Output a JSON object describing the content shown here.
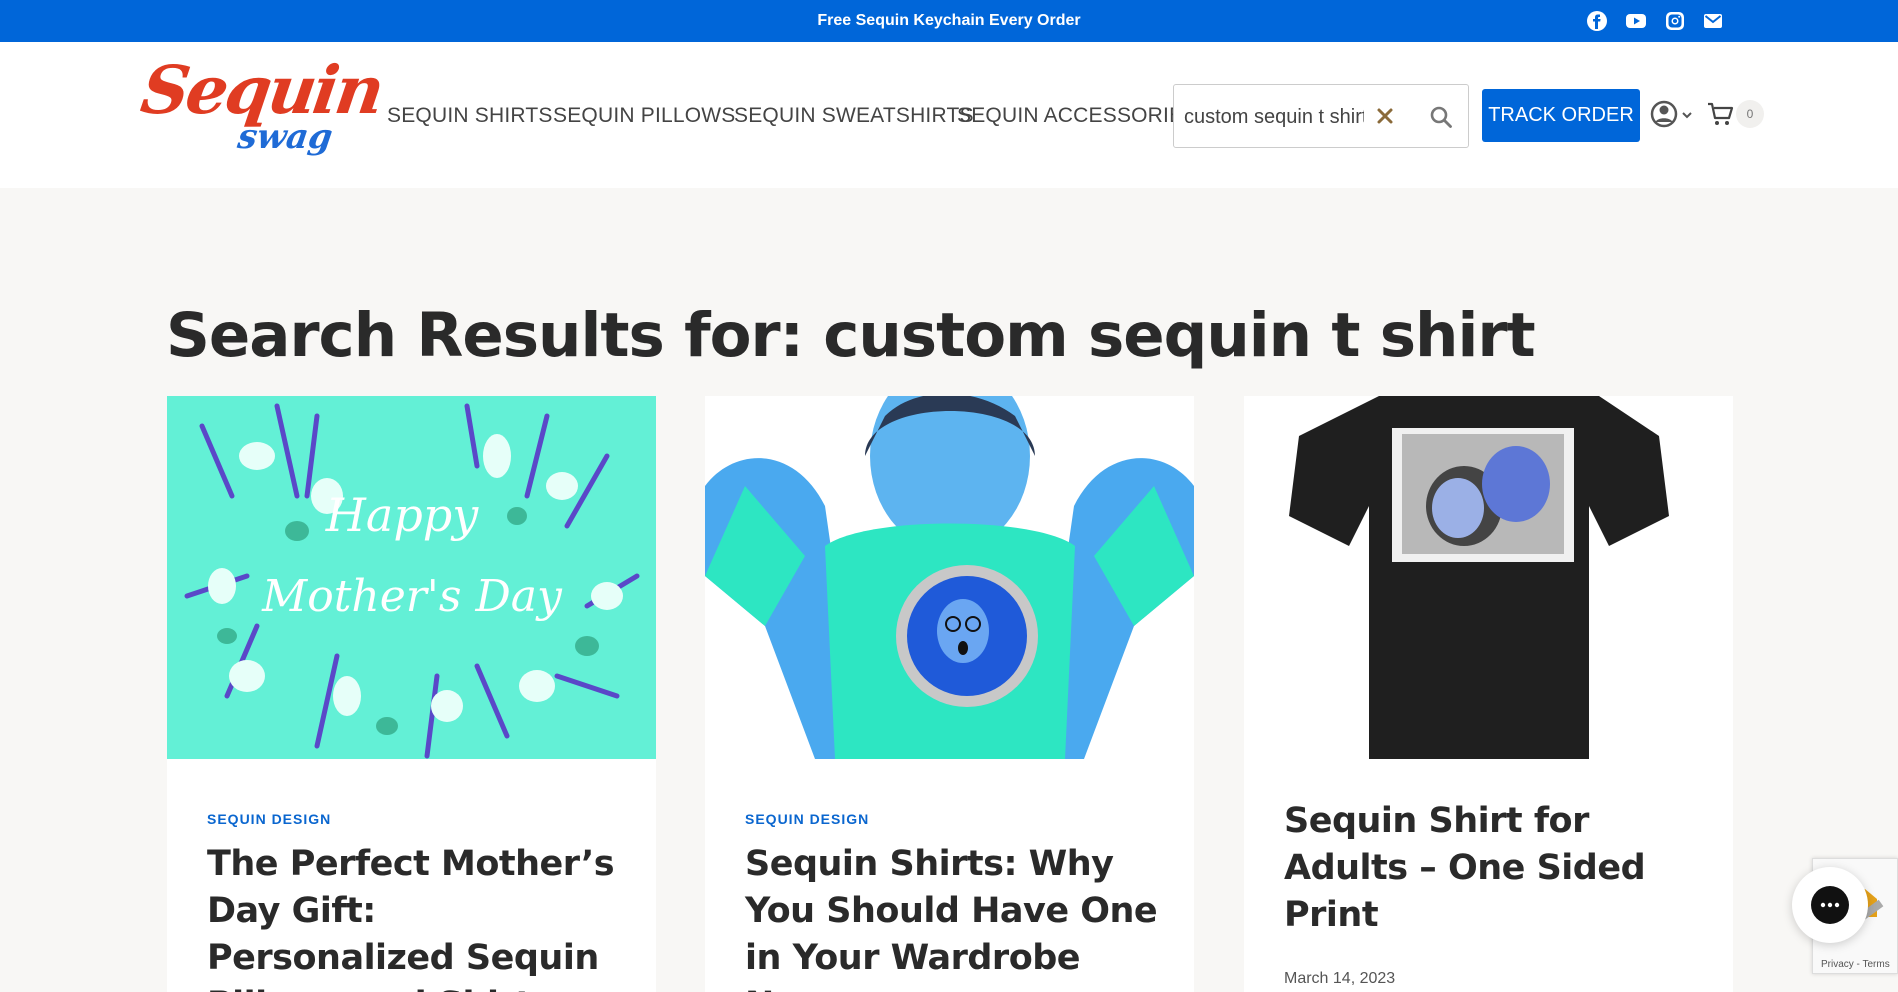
{
  "announcement": {
    "text": "Free Sequin Keychain Every Order"
  },
  "social_icons": [
    "facebook-icon",
    "youtube-icon",
    "instagram-icon",
    "email-icon"
  ],
  "logo": {
    "line1": "Sequin",
    "line2": "swag"
  },
  "nav": {
    "items": [
      {
        "label": "SEQUIN SHIRTS"
      },
      {
        "label": "SEQUIN PILLOWS"
      },
      {
        "label": "SEQUIN SWEATSHIRTS"
      },
      {
        "label": "SEQUIN ACCESSORIES"
      }
    ]
  },
  "search": {
    "value": "custom sequin t shirt",
    "clear_icon": "close-icon",
    "submit_icon": "search-icon"
  },
  "track_order": {
    "label": "TRACK ORDER"
  },
  "cart": {
    "count": "0"
  },
  "page": {
    "title": "Search Results for: custom sequin t shirt"
  },
  "results": [
    {
      "category": "SEQUIN DESIGN",
      "title": "The Perfect Mother’s Day Gift: Personalized Sequin Pillows and Shirts",
      "image_text_1": "Happy",
      "image_text_2": "Mother's Day"
    },
    {
      "category": "SEQUIN DESIGN",
      "title": "Sequin Shirts: Why You Should Have One in Your Wardrobe Now"
    },
    {
      "category": "",
      "title": "Sequin Shirt for Adults – One Sided Print",
      "date": "March 14, 2023"
    }
  ],
  "recaptcha": {
    "text": "Privacy - Terms"
  },
  "colors": {
    "brand_blue": "#0066d9",
    "logo_red": "#e03c22",
    "link_blue": "#0a66cf",
    "mint": "#63f0d6"
  }
}
